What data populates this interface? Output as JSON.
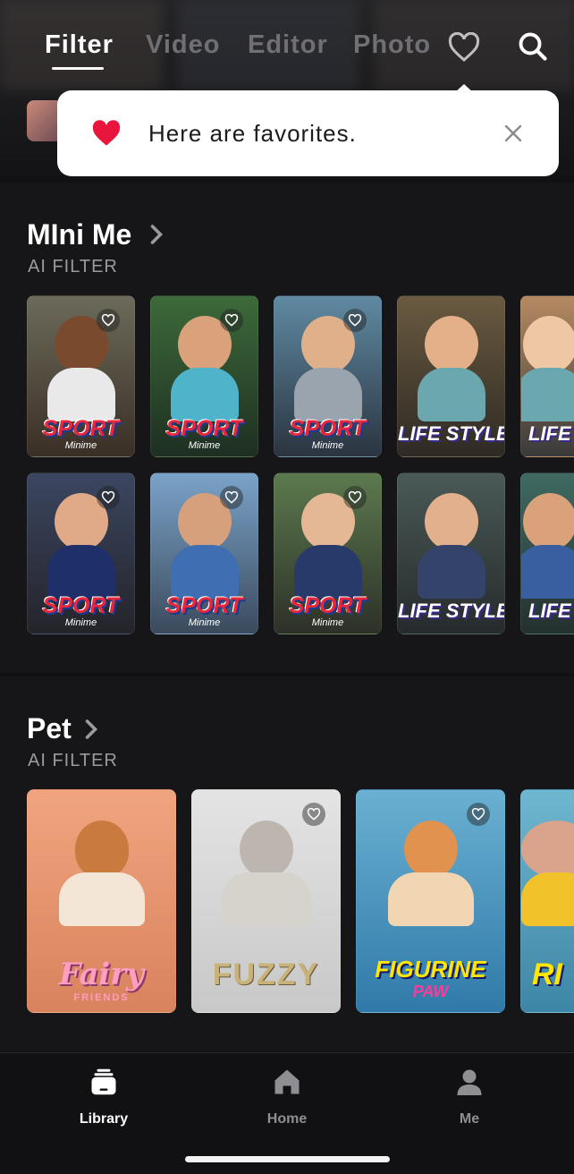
{
  "header": {
    "tabs": [
      {
        "label": "Filter",
        "active": true
      },
      {
        "label": "Video",
        "active": false
      },
      {
        "label": "Editor",
        "active": false
      },
      {
        "label": "Photo",
        "active": false
      }
    ],
    "favorites_icon": "heart-outline-icon",
    "search_icon": "search-icon"
  },
  "tooltip": {
    "icon": "heart-filled-icon",
    "message": "Here are favorites.",
    "close_icon": "close-icon",
    "heart_color": "#e8163c"
  },
  "sections": [
    {
      "title": "MIni Me",
      "subtitle": "AI FILTER",
      "rows": [
        [
          {
            "label": "SPORT",
            "sublabel": "Minime",
            "style": "sport"
          },
          {
            "label": "SPORT",
            "sublabel": "Minime",
            "style": "sport"
          },
          {
            "label": "SPORT",
            "sublabel": "Minime",
            "style": "sport"
          },
          {
            "label": "LIFE STYLE",
            "sublabel": "",
            "style": "life"
          },
          {
            "label": "LIFE S",
            "sublabel": "",
            "style": "life"
          }
        ],
        [
          {
            "label": "SPORT",
            "sublabel": "Minime",
            "style": "sport"
          },
          {
            "label": "SPORT",
            "sublabel": "Minime",
            "style": "sport"
          },
          {
            "label": "SPORT",
            "sublabel": "Minime",
            "style": "sport"
          },
          {
            "label": "LIFE STYLE",
            "sublabel": "",
            "style": "life"
          },
          {
            "label": "LIFE S",
            "sublabel": "",
            "style": "life"
          }
        ]
      ]
    },
    {
      "title": "Pet",
      "subtitle": "AI FILTER",
      "cards": [
        {
          "label": "Fairy",
          "sublabel": "FRIENDS"
        },
        {
          "label": "FUZZY",
          "sublabel": ""
        },
        {
          "label": "FIGURINE",
          "sublabel": "PAW"
        },
        {
          "label": "RI",
          "sublabel": ""
        }
      ]
    }
  ],
  "bottom_nav": [
    {
      "label": "Library",
      "icon": "library-icon",
      "active": true
    },
    {
      "label": "Home",
      "icon": "home-icon",
      "active": false
    },
    {
      "label": "Me",
      "icon": "person-icon",
      "active": false
    }
  ],
  "colors": {
    "background": "#111113",
    "section_background": "#161618",
    "accent_red": "#e8163c"
  }
}
